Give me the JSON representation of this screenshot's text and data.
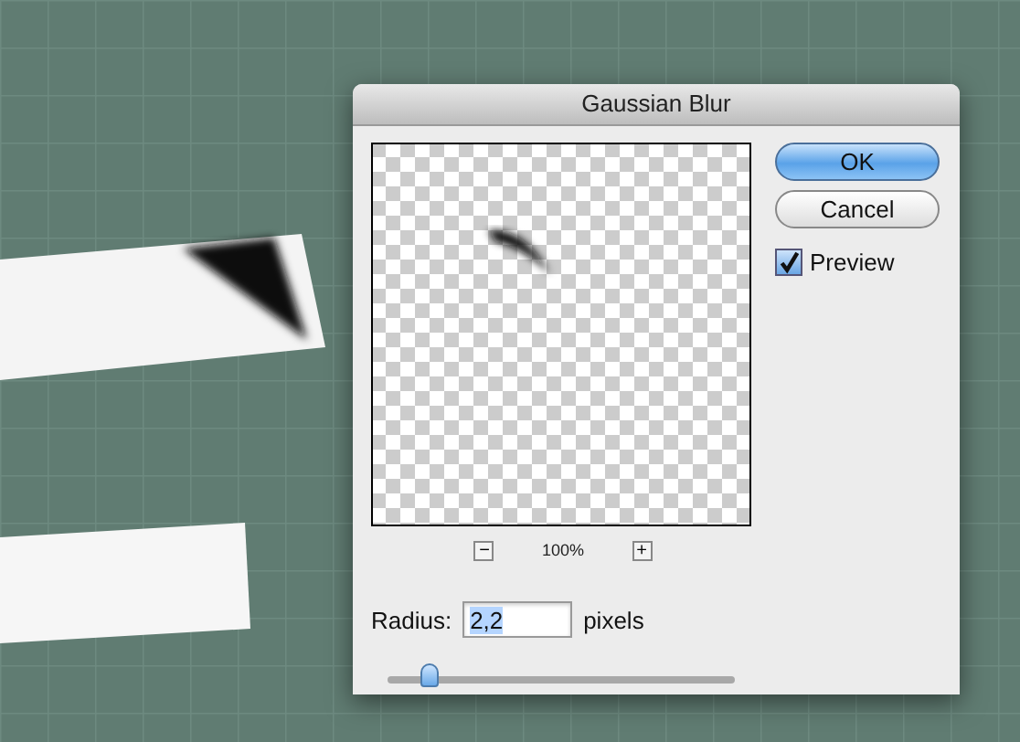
{
  "dialog": {
    "title": "Gaussian Blur",
    "preview": {
      "zoom_out": "−",
      "zoom": "100%",
      "zoom_in": "+"
    },
    "buttons": [
      {
        "label": "OK",
        "kind": "default"
      },
      {
        "label": "Cancel",
        "kind": "normal"
      }
    ],
    "preview_option": {
      "label": "Preview",
      "checked": true
    },
    "radius": {
      "label": "Radius:",
      "value": "2,2",
      "unit": "pixels",
      "level": 0.12
    }
  }
}
